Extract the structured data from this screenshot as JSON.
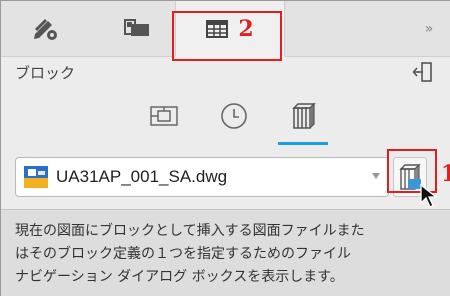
{
  "tabs": [
    {
      "name": "properties",
      "icon": "pencil-gear-icon"
    },
    {
      "name": "layers",
      "icon": "layer-sheet-icon"
    },
    {
      "name": "blocks",
      "icon": "grid-table-icon"
    }
  ],
  "tab_more": "»",
  "annotations": {
    "tab_number": "2",
    "browse_number": "1"
  },
  "panel": {
    "title": "ブロック"
  },
  "subtabs": [
    "current-drawing-icon",
    "recent-clock-icon",
    "library-books-icon"
  ],
  "file": {
    "name": "UA31AP_001_SA.dwg"
  },
  "tooltip": {
    "lines": [
      "現在の図面にブロックとして挿入する図面ファイルまた",
      "はそのブロック定義の１つを指定するためのファイル",
      "ナビゲーション ダイアログ ボックスを表示します。"
    ]
  },
  "colors": {
    "accent": "#1e9ee0",
    "annotation": "#e02020",
    "background": "#ececec"
  }
}
